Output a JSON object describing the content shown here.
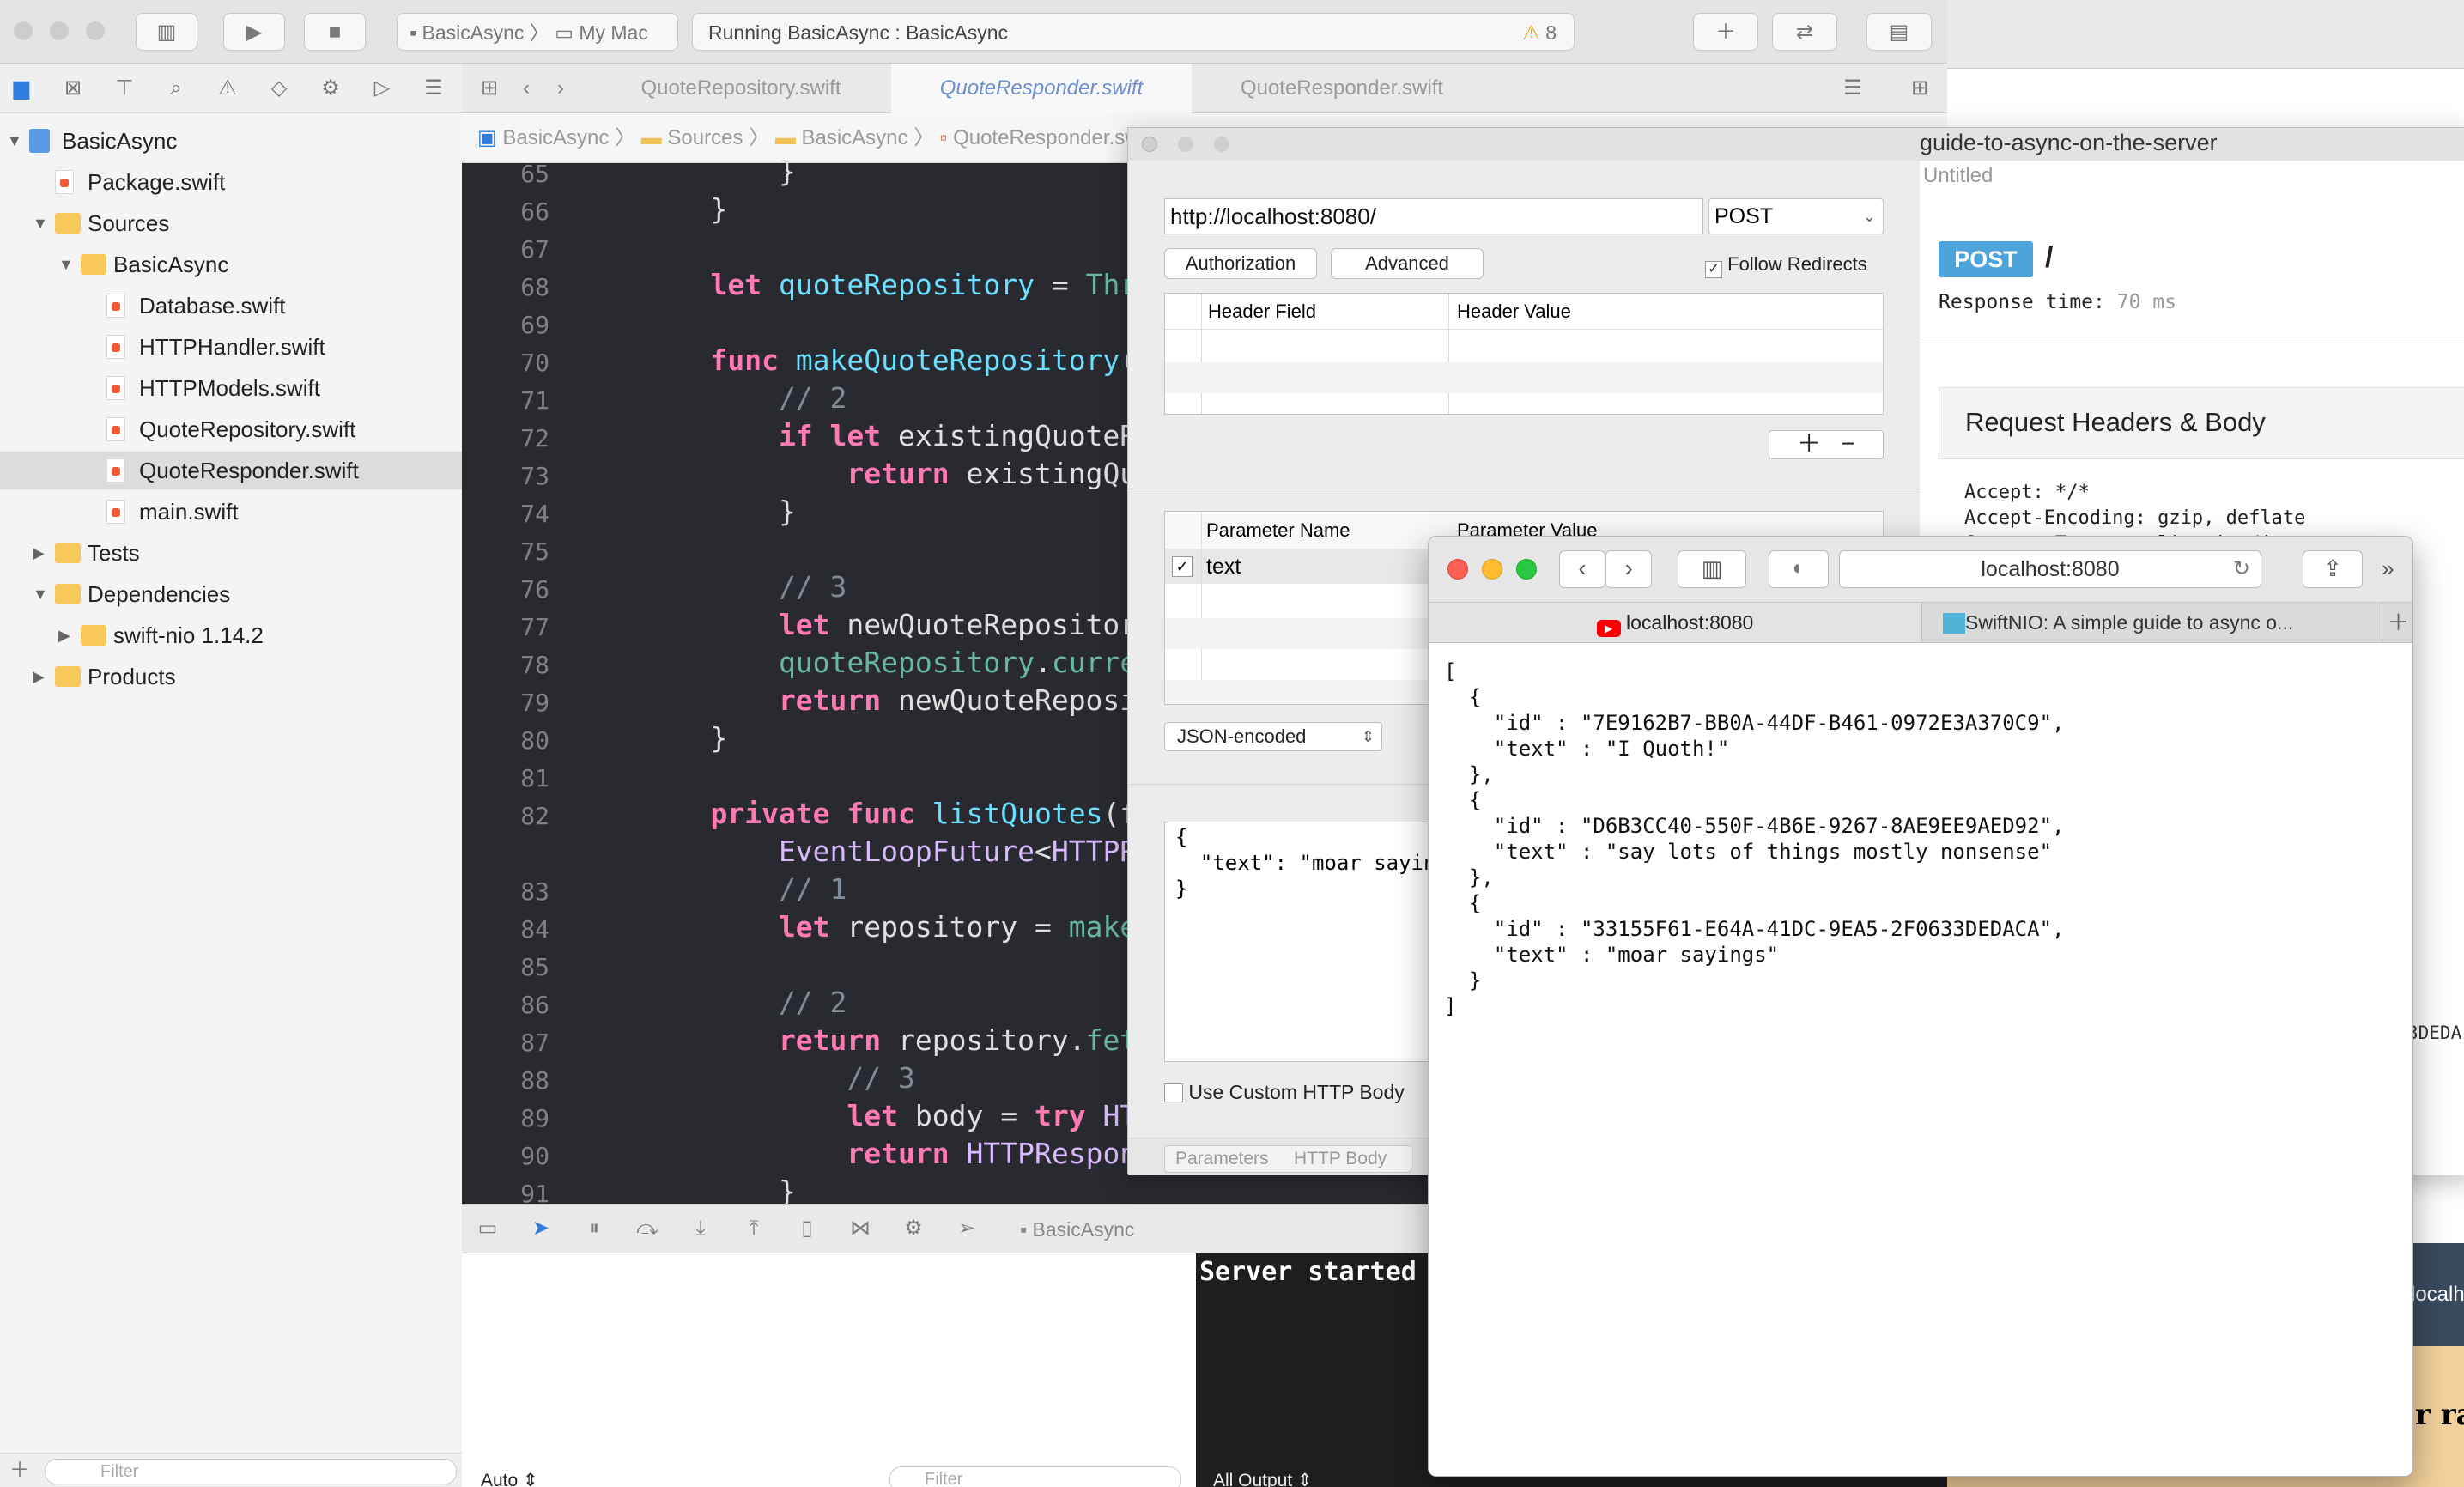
{
  "xcode": {
    "scheme": "BasicAsync",
    "destination": "My Mac",
    "status": "Running BasicAsync : BasicAsync",
    "warnings": "8",
    "tree": [
      {
        "label": "BasicAsync",
        "level": 0,
        "kind": "project",
        "open": true
      },
      {
        "label": "Package.swift",
        "level": 1,
        "kind": "swift"
      },
      {
        "label": "Sources",
        "level": 1,
        "kind": "folder",
        "open": true
      },
      {
        "label": "BasicAsync",
        "level": 2,
        "kind": "folder",
        "open": true
      },
      {
        "label": "Database.swift",
        "level": 3,
        "kind": "swift"
      },
      {
        "label": "HTTPHandler.swift",
        "level": 3,
        "kind": "swift"
      },
      {
        "label": "HTTPModels.swift",
        "level": 3,
        "kind": "swift"
      },
      {
        "label": "QuoteRepository.swift",
        "level": 3,
        "kind": "swift"
      },
      {
        "label": "QuoteResponder.swift",
        "level": 3,
        "kind": "swift",
        "selected": true
      },
      {
        "label": "main.swift",
        "level": 3,
        "kind": "swift"
      },
      {
        "label": "Tests",
        "level": 1,
        "kind": "folder",
        "open": false
      },
      {
        "label": "Dependencies",
        "level": 1,
        "kind": "folder",
        "open": true
      },
      {
        "label": "swift-nio 1.14.2",
        "level": 2,
        "kind": "folder",
        "open": false
      },
      {
        "label": "Products",
        "level": 1,
        "kind": "folder",
        "open": false
      }
    ],
    "filter_placeholder": "Filter",
    "tabs": [
      "QuoteRepository.swift",
      "QuoteResponder.swift",
      "QuoteResponder.swift"
    ],
    "jumpbar": [
      "BasicAsync",
      "Sources",
      "BasicAsync",
      "QuoteResponder.sw"
    ],
    "code": [
      {
        "n": "65",
        "t": [
          {
            "c": "p",
            "s": "        }"
          }
        ]
      },
      {
        "n": "66",
        "t": [
          {
            "c": "p",
            "s": "    }"
          }
        ]
      },
      {
        "n": "67",
        "t": []
      },
      {
        "n": "68",
        "t": [
          {
            "c": "kw",
            "s": "    let "
          },
          {
            "c": "id",
            "s": "quoteRepository"
          },
          {
            "c": "p",
            "s": " = "
          },
          {
            "c": "fn",
            "s": "ThreadS"
          }
        ]
      },
      {
        "n": "69",
        "t": []
      },
      {
        "n": "70",
        "t": [
          {
            "c": "kw",
            "s": "    func "
          },
          {
            "c": "id",
            "s": "makeQuoteRepository"
          },
          {
            "c": "p",
            "s": "(for "
          }
        ]
      },
      {
        "n": "71",
        "t": [
          {
            "c": "cm",
            "s": "        // 2"
          }
        ]
      },
      {
        "n": "72",
        "t": [
          {
            "c": "kw",
            "s": "        if let "
          },
          {
            "c": "p",
            "s": "existingQuoteRepos"
          }
        ]
      },
      {
        "n": "73",
        "t": [
          {
            "c": "kw",
            "s": "            return "
          },
          {
            "c": "p",
            "s": "existingQuoteR"
          }
        ]
      },
      {
        "n": "74",
        "t": [
          {
            "c": "p",
            "s": "        }"
          }
        ]
      },
      {
        "n": "75",
        "t": []
      },
      {
        "n": "76",
        "t": [
          {
            "c": "cm",
            "s": "        // 3"
          }
        ]
      },
      {
        "n": "77",
        "t": [
          {
            "c": "kw",
            "s": "        let "
          },
          {
            "c": "p",
            "s": "newQuoteRepository = "
          }
        ]
      },
      {
        "n": "78",
        "t": [
          {
            "c": "fn",
            "s": "        quoteRepository"
          },
          {
            "c": "p",
            "s": "."
          },
          {
            "c": "fn",
            "s": "currentVa"
          }
        ]
      },
      {
        "n": "79",
        "t": [
          {
            "c": "kw",
            "s": "        return "
          },
          {
            "c": "p",
            "s": "newQuoteRepository"
          }
        ]
      },
      {
        "n": "80",
        "t": [
          {
            "c": "p",
            "s": "    }"
          }
        ]
      },
      {
        "n": "81",
        "t": []
      },
      {
        "n": "82",
        "t": [
          {
            "c": "kw",
            "s": "    private func "
          },
          {
            "c": "id",
            "s": "listQuotes"
          },
          {
            "c": "p",
            "s": "(for r"
          }
        ]
      },
      {
        "n": "",
        "t": [
          {
            "c": "ty",
            "s": "        EventLoopFuture"
          },
          {
            "c": "p",
            "s": "<"
          },
          {
            "c": "ty",
            "s": "HTTPRespo"
          }
        ]
      },
      {
        "n": "83",
        "t": [
          {
            "c": "cm",
            "s": "        // 1"
          }
        ]
      },
      {
        "n": "84",
        "t": [
          {
            "c": "kw",
            "s": "        let "
          },
          {
            "c": "p",
            "s": "repository = "
          },
          {
            "c": "fn",
            "s": "makeQuot"
          }
        ]
      },
      {
        "n": "85",
        "t": []
      },
      {
        "n": "86",
        "t": [
          {
            "c": "cm",
            "s": "        // 2"
          }
        ]
      },
      {
        "n": "87",
        "t": [
          {
            "c": "kw",
            "s": "        return "
          },
          {
            "c": "p",
            "s": "repository."
          },
          {
            "c": "fn",
            "s": "fetchAl"
          }
        ]
      },
      {
        "n": "88",
        "t": [
          {
            "c": "cm",
            "s": "            // 3"
          }
        ]
      },
      {
        "n": "89",
        "t": [
          {
            "c": "kw",
            "s": "            let "
          },
          {
            "c": "p",
            "s": "body = "
          },
          {
            "c": "kw",
            "s": "try "
          },
          {
            "c": "ty",
            "s": "HTTPBo"
          }
        ]
      },
      {
        "n": "90",
        "t": [
          {
            "c": "kw",
            "s": "            return "
          },
          {
            "c": "ty",
            "s": "HTTPResponse"
          },
          {
            "c": "p",
            "s": "(s"
          }
        ]
      },
      {
        "n": "91",
        "t": [
          {
            "c": "p",
            "s": "        }"
          }
        ]
      }
    ],
    "debug_target": "BasicAsync",
    "console_text": "Server started",
    "auto_label": "Auto",
    "all_output": "All Output",
    "filter2": "Filter"
  },
  "paw": {
    "url": "http://localhost:8080/",
    "method": "POST",
    "authorization": "Authorization",
    "advanced": "Advanced",
    "follow_redirects": "Follow Redirects",
    "header_field": "Header Field",
    "header_value": "Header Value",
    "param_name": "Parameter Name",
    "param_value": "Parameter Value",
    "param_row": "text",
    "encoding": "JSON-encoded",
    "body": "{\n  \"text\": \"moar sayin\n}",
    "use_custom": "Use Custom HTTP Body",
    "tab_params": "Parameters",
    "tab_body": "HTTP Body",
    "resp_method": "POST",
    "resp_path": "/",
    "resp_time_label": "Response time:",
    "resp_time": "70 ms",
    "section_title": "Request Headers & Body",
    "headers": "Accept: */*\nAccept-Encoding: gzip, deflate\nContent-Type: application/json\nAccept-Language: en-us",
    "bg_title": "guide-to-async-on-the-server",
    "bg_sub": "Untitled",
    "side_frag": "3DEDA"
  },
  "safari": {
    "address": "localhost:8080",
    "tab1": "localhost:8080",
    "tab2": "SwiftNIO: A simple guide to async o...",
    "json": "[\n  {\n    \"id\" : \"7E9162B7-BB0A-44DF-B461-0972E3A370C9\",\n    \"text\" : \"I Quoth!\"\n  },\n  {\n    \"id\" : \"D6B3CC40-550F-4B6E-9267-8AE9EE9AED92\",\n    \"text\" : \"say lots of things mostly nonsense\"\n  },\n  {\n    \"id\" : \"33155F61-E64A-41DC-9EA5-2F0633DEDACA\",\n    \"text\" : \"moar sayings\"\n  }\n]"
  },
  "bg_right": {
    "frag1": "localh",
    "frag2": "r ra"
  },
  "colors": {
    "accent": "#4ea4d9",
    "kw": "#ff7ab2",
    "id": "#6bdfff",
    "fn": "#67b7a4",
    "editor_bg": "#292a30"
  }
}
